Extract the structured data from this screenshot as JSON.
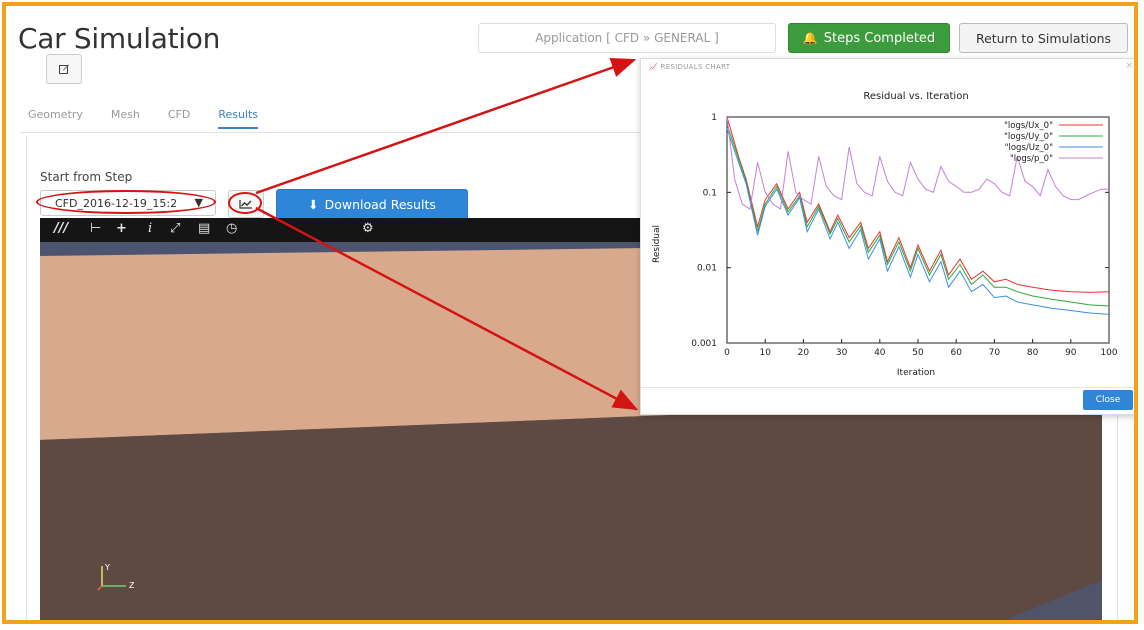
{
  "header": {
    "title": "Car Simulation",
    "application": "Application [ CFD » GENERAL ]",
    "steps_completed": "Steps Completed",
    "return_label": "Return to Simulations"
  },
  "tabs": [
    {
      "label": "Geometry",
      "active": false
    },
    {
      "label": "Mesh",
      "active": false
    },
    {
      "label": "CFD",
      "active": false
    },
    {
      "label": "Results",
      "active": true
    }
  ],
  "results": {
    "start_label": "Start from Step",
    "selected_step": "CFD_2016-12-19_15:2",
    "download_label": "Download Results"
  },
  "viewer": {
    "axis_y": "Y",
    "axis_z": "Z"
  },
  "dialog": {
    "title": "RESIDUALS CHART",
    "close_label": "Close"
  },
  "colors": {
    "accent_blue": "#2f86d8",
    "success_green": "#3c9b3c",
    "frame_orange": "#f5a21b",
    "annotation_red": "#d41313"
  },
  "chart_data": {
    "type": "line",
    "title": "Residual vs. Iteration",
    "xlabel": "Iteration",
    "ylabel": "Residual",
    "xlim": [
      0,
      100
    ],
    "ylim": [
      0.001,
      1
    ],
    "yscale": "log",
    "x_ticks": [
      "0",
      "10",
      "20",
      "30",
      "40",
      "50",
      "60",
      "70",
      "80",
      "90",
      "100"
    ],
    "y_ticks": [
      "1",
      "0.1",
      "0.01",
      "0.001"
    ],
    "legend_position": "top-right",
    "series": [
      {
        "name": "\"logs/Ux_0\"",
        "color": "#e8332f",
        "x": [
          0,
          3,
          5,
          8,
          10,
          13,
          16,
          19,
          21,
          24,
          27,
          29,
          32,
          35,
          37,
          40,
          42,
          45,
          48,
          50,
          53,
          56,
          58,
          61,
          64,
          67,
          70,
          73,
          76,
          80,
          85,
          90,
          95,
          100
        ],
        "y": [
          1.0,
          0.3,
          0.15,
          0.035,
          0.08,
          0.13,
          0.06,
          0.1,
          0.04,
          0.07,
          0.03,
          0.05,
          0.025,
          0.04,
          0.018,
          0.03,
          0.012,
          0.025,
          0.01,
          0.02,
          0.009,
          0.017,
          0.008,
          0.013,
          0.007,
          0.009,
          0.0065,
          0.007,
          0.006,
          0.0055,
          0.005,
          0.0048,
          0.0047,
          0.0048
        ]
      },
      {
        "name": "\"logs/Uy_0\"",
        "color": "#2da836",
        "x": [
          0,
          3,
          5,
          8,
          10,
          13,
          16,
          19,
          21,
          24,
          27,
          29,
          32,
          35,
          37,
          40,
          42,
          45,
          48,
          50,
          53,
          56,
          58,
          61,
          64,
          67,
          70,
          73,
          76,
          80,
          85,
          90,
          95,
          100
        ],
        "y": [
          0.8,
          0.28,
          0.14,
          0.03,
          0.07,
          0.12,
          0.055,
          0.09,
          0.035,
          0.065,
          0.028,
          0.045,
          0.022,
          0.036,
          0.016,
          0.027,
          0.011,
          0.022,
          0.009,
          0.018,
          0.008,
          0.015,
          0.007,
          0.011,
          0.006,
          0.008,
          0.0055,
          0.0055,
          0.0048,
          0.0042,
          0.0038,
          0.0035,
          0.0032,
          0.0031
        ]
      },
      {
        "name": "\"logs/Uz_0\"",
        "color": "#3b8fe0",
        "x": [
          0,
          3,
          5,
          8,
          10,
          13,
          16,
          19,
          21,
          24,
          27,
          29,
          32,
          35,
          37,
          40,
          42,
          45,
          48,
          50,
          53,
          56,
          58,
          61,
          64,
          67,
          70,
          73,
          76,
          80,
          85,
          90,
          95,
          100
        ],
        "y": [
          0.7,
          0.25,
          0.13,
          0.027,
          0.065,
          0.11,
          0.05,
          0.085,
          0.03,
          0.06,
          0.024,
          0.04,
          0.018,
          0.032,
          0.013,
          0.024,
          0.009,
          0.019,
          0.0075,
          0.015,
          0.0065,
          0.012,
          0.0055,
          0.009,
          0.0048,
          0.006,
          0.004,
          0.0042,
          0.0035,
          0.0032,
          0.0029,
          0.0027,
          0.0025,
          0.0024
        ]
      },
      {
        "name": "\"logs/p_0\"",
        "color": "#c57fd9",
        "x": [
          0,
          2,
          4,
          6,
          8,
          10,
          12,
          14,
          16,
          18,
          20,
          22,
          24,
          26,
          28,
          30,
          32,
          34,
          36,
          38,
          40,
          42,
          44,
          46,
          48,
          50,
          52,
          54,
          56,
          58,
          60,
          62,
          64,
          66,
          68,
          70,
          72,
          74,
          76,
          78,
          80,
          82,
          84,
          86,
          88,
          90,
          92,
          94,
          96,
          98,
          100
        ],
        "y": [
          1.0,
          0.15,
          0.07,
          0.06,
          0.25,
          0.1,
          0.07,
          0.06,
          0.35,
          0.1,
          0.08,
          0.07,
          0.3,
          0.12,
          0.09,
          0.08,
          0.4,
          0.13,
          0.1,
          0.09,
          0.3,
          0.14,
          0.1,
          0.09,
          0.25,
          0.15,
          0.11,
          0.1,
          0.22,
          0.14,
          0.12,
          0.1,
          0.1,
          0.11,
          0.15,
          0.13,
          0.1,
          0.09,
          0.3,
          0.14,
          0.12,
          0.09,
          0.2,
          0.12,
          0.09,
          0.08,
          0.08,
          0.09,
          0.1,
          0.11,
          0.11
        ]
      }
    ]
  }
}
